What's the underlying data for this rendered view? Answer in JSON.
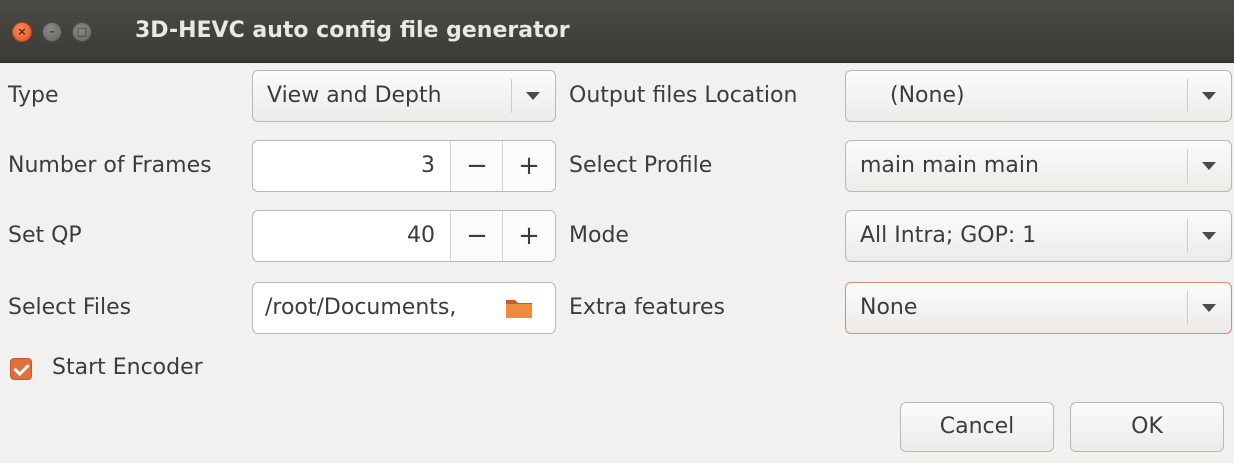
{
  "window": {
    "title": "3D-HEVC auto config file generator"
  },
  "left": {
    "type_label": "Type",
    "type_value": "View and Depth",
    "frames_label": "Number of Frames",
    "frames_value": "3",
    "qp_label": "Set QP",
    "qp_value": "40",
    "files_label": "Select Files",
    "files_value": "/root/Documents,"
  },
  "right": {
    "output_label": "Output files Location",
    "output_value": "(None)",
    "profile_label": "Select Profile",
    "profile_value": "main main main",
    "mode_label": "Mode",
    "mode_value": "All Intra; GOP: 1",
    "extra_label": "Extra features",
    "extra_value": "None"
  },
  "start_encoder": {
    "label": "Start Encoder",
    "checked": true
  },
  "buttons": {
    "cancel": "Cancel",
    "ok": "OK"
  },
  "spin_symbols": {
    "minus": "−",
    "plus": "+"
  },
  "colors": {
    "accent": "#e0703a",
    "titlebar": "#3b3a37",
    "background": "#f2f1f0"
  }
}
